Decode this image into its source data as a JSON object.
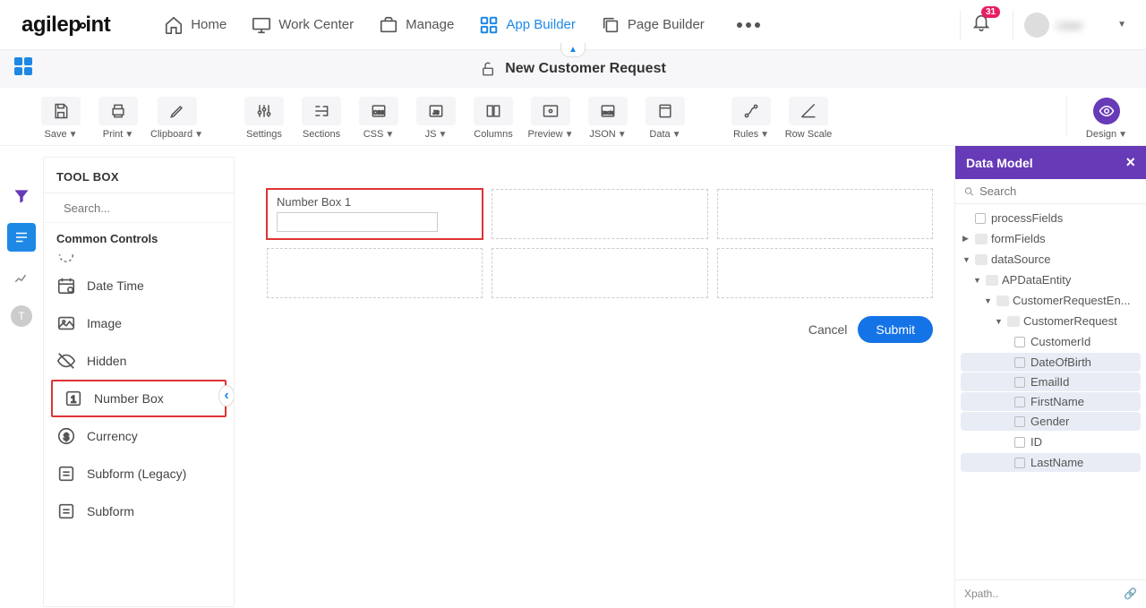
{
  "logo": "agilepoint",
  "nav": {
    "home": "Home",
    "workcenter": "Work Center",
    "manage": "Manage",
    "appbuilder": "App Builder",
    "pagebuilder": "Page Builder"
  },
  "notification_count": "31",
  "user_name": "User",
  "document_title": "New Customer Request",
  "toolbar": {
    "save": "Save",
    "print": "Print",
    "clipboard": "Clipboard",
    "settings": "Settings",
    "sections": "Sections",
    "css": "CSS",
    "js": "JS",
    "columns": "Columns",
    "preview": "Preview",
    "json": "JSON",
    "data": "Data",
    "rules": "Rules",
    "rowscale": "Row Scale",
    "design": "Design"
  },
  "toolbox": {
    "title": "TOOL BOX",
    "search_placeholder": "Search...",
    "section": "Common Controls",
    "items": {
      "datetime": "Date Time",
      "image": "Image",
      "hidden": "Hidden",
      "numberbox": "Number Box",
      "currency": "Currency",
      "subformlegacy": "Subform (Legacy)",
      "subform": "Subform"
    }
  },
  "canvas": {
    "numberbox_label": "Number Box 1",
    "cancel": "Cancel",
    "submit": "Submit"
  },
  "data_model": {
    "title": "Data Model",
    "search_placeholder": "Search",
    "xpath": "Xpath..",
    "tree": {
      "processFields": "processFields",
      "formFields": "formFields",
      "dataSource": "dataSource",
      "apDataEntity": "APDataEntity",
      "customerRequestEn": "CustomerRequestEn...",
      "customerRequest": "CustomerRequest",
      "customerId": "CustomerId",
      "dateOfBirth": "DateOfBirth",
      "emailId": "EmailId",
      "firstName": "FirstName",
      "gender": "Gender",
      "id": "ID",
      "lastName": "LastName"
    }
  }
}
